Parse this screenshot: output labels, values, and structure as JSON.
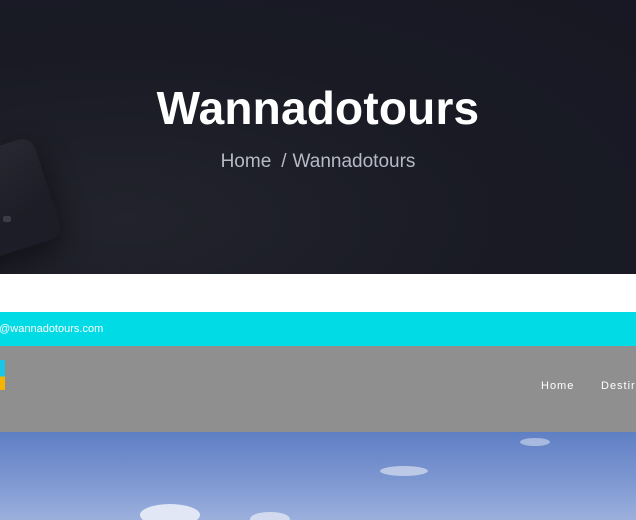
{
  "hero": {
    "title": "Wannadotours",
    "breadcrumb": {
      "home": "Home",
      "separator": "/",
      "current": "Wannadotours"
    }
  },
  "preview": {
    "topbar_email": "o@wannadotours.com",
    "nav": {
      "home": "Home",
      "destinations_partial": "Destir"
    }
  },
  "colors": {
    "hero_bg": "#191a24",
    "topbar_bg": "#00dbe6",
    "nav_bg": "#8f8f8f",
    "breadcrumb_text": "#b6b9c6"
  }
}
